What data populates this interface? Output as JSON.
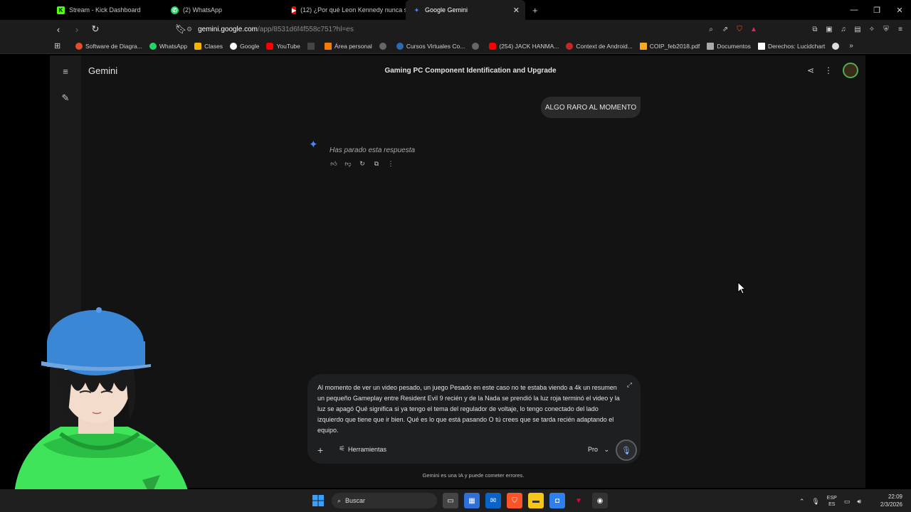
{
  "tabs": [
    {
      "title": "Stream - Kick Dashboard",
      "fav_color": "#53fc18",
      "fav_glyph": "K"
    },
    {
      "title": "(2) WhatsApp",
      "fav_color": "#25d366",
      "fav_glyph": "W"
    },
    {
      "title": "(12) ¿Por qué Leon Kennedy nunca s",
      "fav_color": "#ff0000",
      "fav_glyph": "▶"
    },
    {
      "title": "Google Gemini",
      "fav_color": "#4a86f5",
      "fav_glyph": "✦"
    }
  ],
  "address": {
    "host": "gemini.google.com",
    "path": "/app/8531d6f4f558c751?hl=es"
  },
  "bookmarks": [
    {
      "label": "Software de Diagra...",
      "color": "#e44d26"
    },
    {
      "label": "WhatsApp",
      "color": "#25d366"
    },
    {
      "label": "Clases",
      "color": "#f4b400"
    },
    {
      "label": "Google",
      "color": "#4285f4"
    },
    {
      "label": "YouTube",
      "color": "#ff0000"
    },
    {
      "label": "",
      "color": "#444444"
    },
    {
      "label": "Área personal",
      "color": "#f57c00"
    },
    {
      "label": "",
      "color": "#666666"
    },
    {
      "label": "Cursos Virtuales Co...",
      "color": "#2b6cb0"
    },
    {
      "label": "",
      "color": "#666666"
    },
    {
      "label": "(254) JACK HANMA...",
      "color": "#ff0000"
    },
    {
      "label": "Context de Android...",
      "color": "#c62828"
    },
    {
      "label": "COIP_feb2018.pdf",
      "color": "#f9a825"
    },
    {
      "label": "Documentos",
      "color": "#aaaaaa"
    },
    {
      "label": "Derechos: Lucidchart",
      "color": "#ffffff"
    }
  ],
  "app": {
    "brand": "Gemini",
    "chat_title": "Gaming PC Component Identification and Upgrade",
    "user_message": "ALGO RARO AL MOMENTO",
    "stopped_text": "Has parado esta respuesta",
    "composer_text": "Al momento de ver un video pesado, un juego Pesado en este caso no te estaba viendo a 4k un resumen un pequeño Gameplay entre Resident Evil 9 recién y de la Nada se prendió la luz roja terminó el video y la luz se apagó Qué significa si ya tengo el tema del regulador de voltaje, lo tengo conectado del lado izquierdo que tiene que ir bien. Qué es lo que está pasando O tú crees que se tarda recién adaptando el equipo.",
    "tools_label": "Herramientas",
    "model_label": "Pro",
    "disclaimer": "Gemini es una IA y puede cometer errores."
  },
  "taskbar": {
    "search_placeholder": "Buscar",
    "lang_top": "ESP",
    "lang_bottom": "ES",
    "time": "22:09",
    "date": "2/3/2026"
  }
}
